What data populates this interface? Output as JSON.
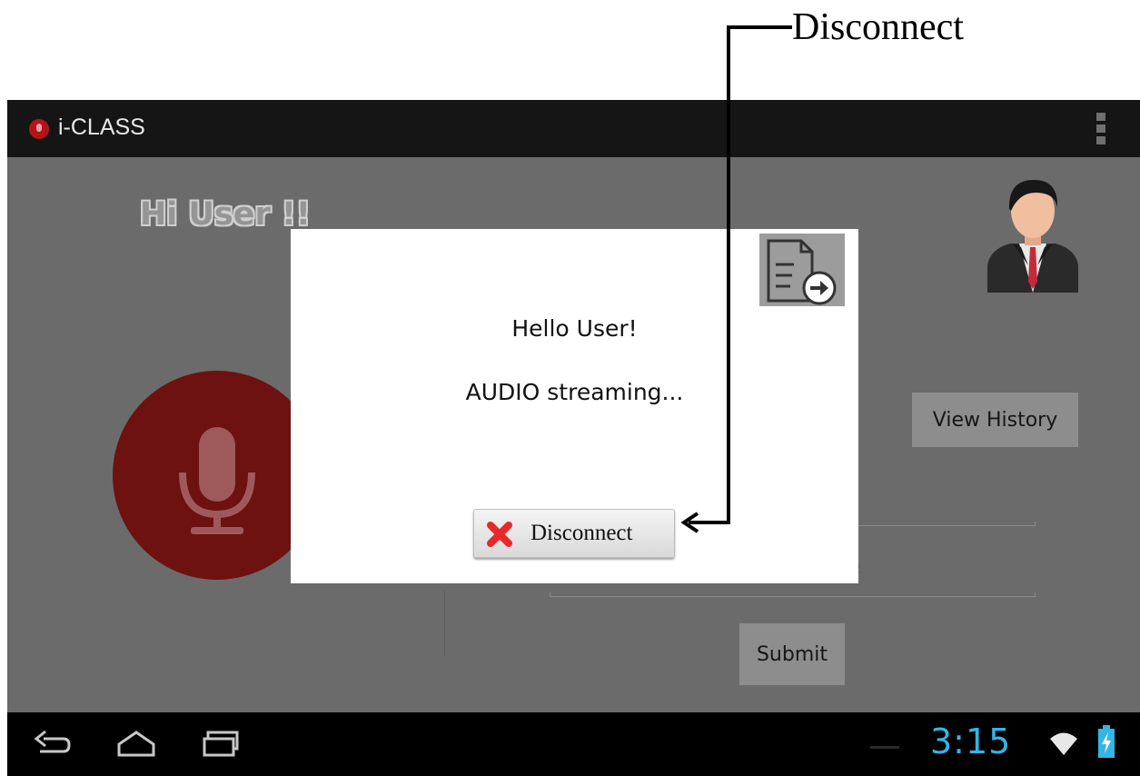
{
  "annotation": {
    "label": "Disconnect"
  },
  "app": {
    "title": "i-CLASS",
    "greeting": "Hi User !!"
  },
  "main": {
    "view_history_label": "View History",
    "field_hint_partial": "re",
    "submit_label": "Submit"
  },
  "dialog": {
    "line1": "Hello User!",
    "line2": "AUDIO streaming...",
    "disconnect_label": "Disconnect"
  },
  "status_bar": {
    "time": "3:15"
  },
  "colors": {
    "clock_accent": "#33b5e5",
    "mic_circle": "#6d1111",
    "disconnect_x": "#e8282b"
  },
  "icons": [
    "mic-icon",
    "overflow-menu-icon",
    "user-avatar-icon",
    "document-send-icon",
    "close-x-icon",
    "back-icon",
    "home-icon",
    "recent-apps-icon",
    "wifi-icon",
    "battery-icon"
  ]
}
